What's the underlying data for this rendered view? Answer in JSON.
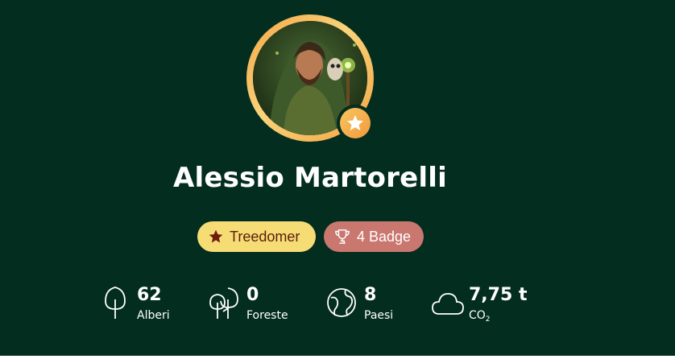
{
  "profile": {
    "name": "Alessio Martorelli",
    "role_label": "Treedomer",
    "badge_label": "4 Badge"
  },
  "stats": {
    "trees": {
      "value": "62",
      "label": "Alberi",
      "icon": "tree-icon"
    },
    "forests": {
      "value": "0",
      "label": "Foreste",
      "icon": "forest-icon"
    },
    "countries": {
      "value": "8",
      "label": "Paesi",
      "icon": "globe-icon"
    },
    "co2": {
      "value": "7,75 t",
      "label": "CO",
      "label_sub": "2",
      "icon": "cloud-icon"
    }
  },
  "colors": {
    "background": "#032d1f",
    "ring": "#f4b04f",
    "role_pill": "#f6dc74",
    "badge_pill": "#c9776f"
  }
}
